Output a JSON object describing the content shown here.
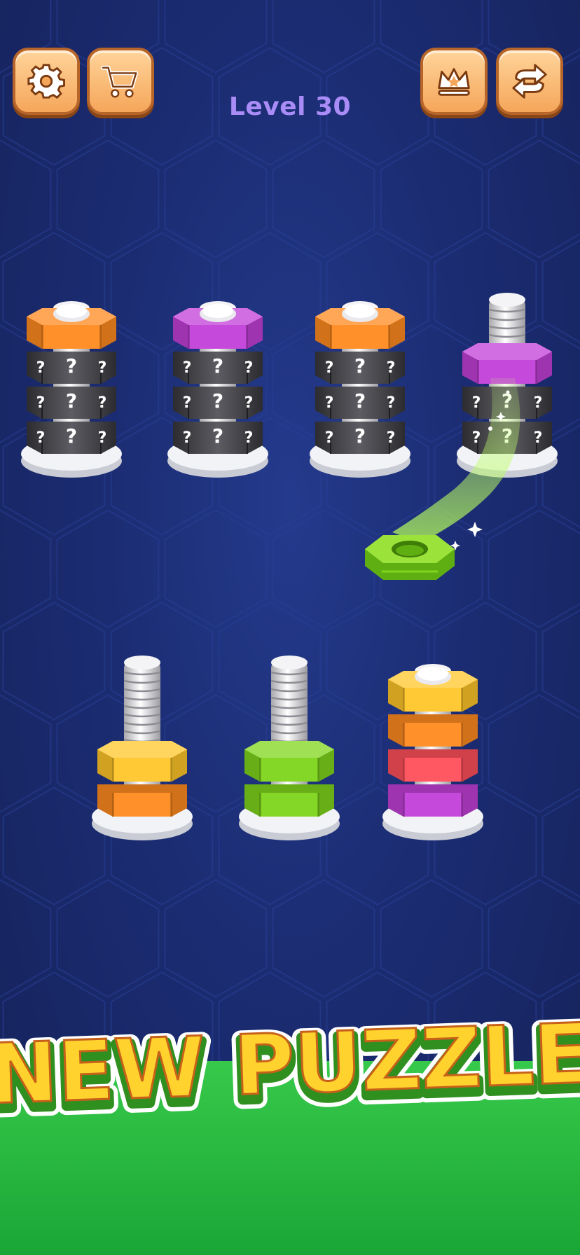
{
  "level": {
    "label": "Level 30"
  },
  "top_left_buttons": [
    {
      "name": "settings-button",
      "icon": "gear-icon"
    },
    {
      "name": "shop-button",
      "icon": "cart-icon"
    }
  ],
  "top_right_buttons": [
    {
      "name": "leaderboard-button",
      "icon": "crown-icon"
    },
    {
      "name": "restart-button",
      "icon": "swap-arrows-icon"
    }
  ],
  "colors": {
    "orange": "#ff8a1f",
    "purple": "#c23fd8",
    "yellow": "#ffc62a",
    "red": "#ff4f5a",
    "green": "#7fd51c",
    "hidden": "#4a4a4f",
    "button": "#f5a65a"
  },
  "board": {
    "top_row": [
      {
        "nuts": [
          "hidden",
          "hidden",
          "hidden",
          "orange"
        ]
      },
      {
        "nuts": [
          "hidden",
          "hidden",
          "hidden",
          "purple"
        ]
      },
      {
        "nuts": [
          "hidden",
          "hidden",
          "hidden",
          "orange"
        ]
      },
      {
        "nuts": [
          "hidden",
          "hidden",
          "purple"
        ]
      }
    ],
    "bottom_row": [
      {
        "nuts": [
          "orange",
          "yellow"
        ]
      },
      {
        "nuts": [
          "green",
          "green"
        ]
      },
      {
        "nuts": [
          "purple",
          "red",
          "orange",
          "yellow"
        ]
      }
    ],
    "hidden_symbol": "?",
    "moving_nut": "green"
  },
  "banner": {
    "text": "NEW PUZZLE"
  }
}
